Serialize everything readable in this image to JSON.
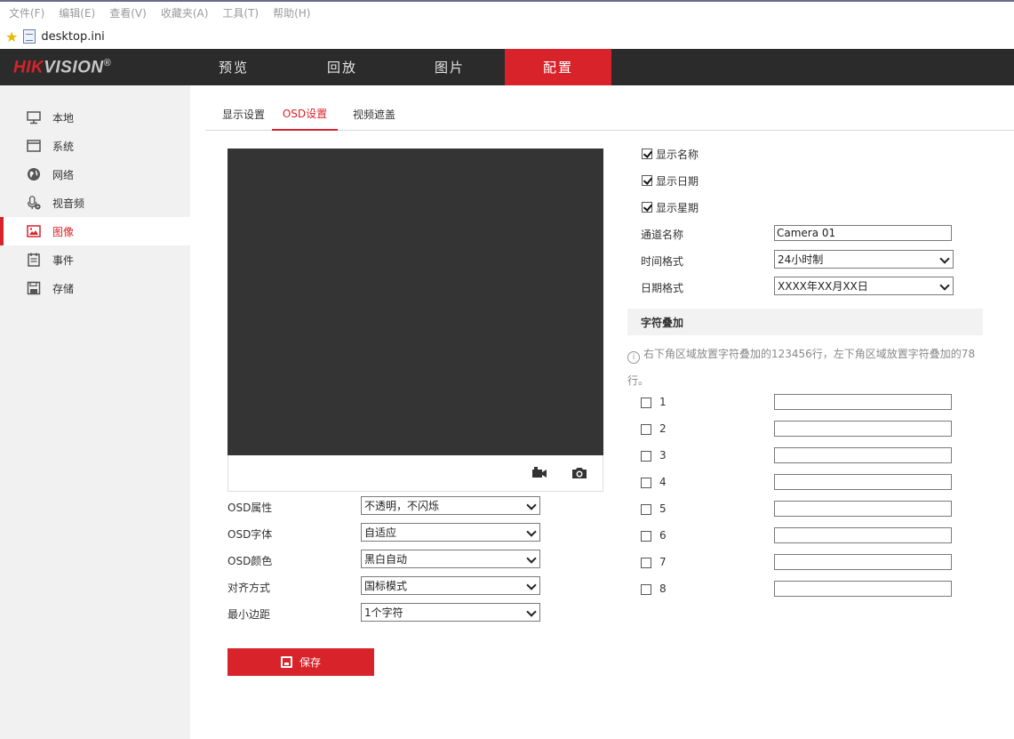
{
  "browser": {
    "menu": [
      "文件(F)",
      "编辑(E)",
      "查看(V)",
      "收藏夹(A)",
      "工具(T)",
      "帮助(H)"
    ],
    "favorite": "desktop.ini"
  },
  "brand": {
    "part1": "HIK",
    "part2": "VISION",
    "reg": "®"
  },
  "nav": {
    "tabs": [
      "预览",
      "回放",
      "图片",
      "配置"
    ],
    "active": "配置"
  },
  "sidebar": {
    "items": [
      {
        "label": "本地",
        "icon": "monitor-icon"
      },
      {
        "label": "系统",
        "icon": "window-icon"
      },
      {
        "label": "网络",
        "icon": "globe-icon"
      },
      {
        "label": "视音频",
        "icon": "mic-icon"
      },
      {
        "label": "图像",
        "icon": "image-icon"
      },
      {
        "label": "事件",
        "icon": "calendar-icon"
      },
      {
        "label": "存储",
        "icon": "disk-icon"
      }
    ],
    "active": "图像"
  },
  "subtabs": {
    "items": [
      "显示设置",
      "OSD设置",
      "视频遮盖"
    ],
    "active": "OSD设置"
  },
  "osd_left": {
    "rows": [
      {
        "label": "OSD属性",
        "value": "不透明，不闪烁"
      },
      {
        "label": "OSD字体",
        "value": "自适应"
      },
      {
        "label": "OSD颜色",
        "value": "黑白自动"
      },
      {
        "label": "对齐方式",
        "value": "国标模式"
      },
      {
        "label": "最小边距",
        "value": "1个字符"
      }
    ]
  },
  "display": {
    "show_name": {
      "label": "显示名称",
      "checked": true
    },
    "show_date": {
      "label": "显示日期",
      "checked": true
    },
    "show_week": {
      "label": "显示星期",
      "checked": true
    },
    "channel_name": {
      "label": "通道名称",
      "value": "Camera 01"
    },
    "time_format": {
      "label": "时间格式",
      "value": "24小时制"
    },
    "date_format": {
      "label": "日期格式",
      "value": "XXXX年XX月XX日"
    }
  },
  "overlay": {
    "title": "字符叠加",
    "hint_line1": "右下角区域放置字符叠加的123456行，左下角区域放置字符叠加的78",
    "hint_line2": "行。",
    "hint_icon": "i",
    "items": [
      {
        "label": "1",
        "checked": false,
        "value": ""
      },
      {
        "label": "2",
        "checked": false,
        "value": ""
      },
      {
        "label": "3",
        "checked": false,
        "value": ""
      },
      {
        "label": "4",
        "checked": false,
        "value": ""
      },
      {
        "label": "5",
        "checked": false,
        "value": ""
      },
      {
        "label": "6",
        "checked": false,
        "value": ""
      },
      {
        "label": "7",
        "checked": false,
        "value": ""
      },
      {
        "label": "8",
        "checked": false,
        "value": ""
      }
    ]
  },
  "actions": {
    "save": "保存"
  },
  "colors": {
    "accent": "#d8232a",
    "navbar": "#2b2b2b",
    "preview": "#343434"
  }
}
